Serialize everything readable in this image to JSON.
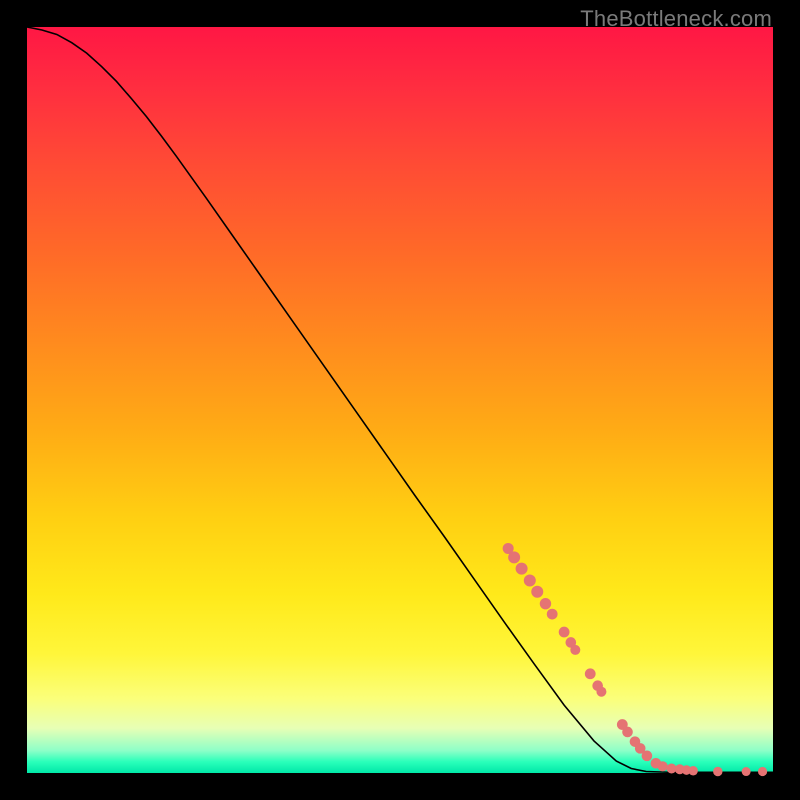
{
  "watermark": "TheBottleneck.com",
  "chart_data": {
    "type": "line",
    "title": "",
    "xlabel": "",
    "ylabel": "",
    "xlim": [
      0,
      100
    ],
    "ylim": [
      0,
      100
    ],
    "curve_points": [
      {
        "x": 0.0,
        "y": 100.0
      },
      {
        "x": 2.0,
        "y": 99.6
      },
      {
        "x": 4.0,
        "y": 99.0
      },
      {
        "x": 6.0,
        "y": 97.9
      },
      {
        "x": 8.0,
        "y": 96.5
      },
      {
        "x": 10.0,
        "y": 94.7
      },
      {
        "x": 12.0,
        "y": 92.7
      },
      {
        "x": 14.0,
        "y": 90.4
      },
      {
        "x": 16.0,
        "y": 88.0
      },
      {
        "x": 18.0,
        "y": 85.4
      },
      {
        "x": 20.0,
        "y": 82.7
      },
      {
        "x": 24.0,
        "y": 77.1
      },
      {
        "x": 28.0,
        "y": 71.4
      },
      {
        "x": 32.0,
        "y": 65.7
      },
      {
        "x": 36.0,
        "y": 60.0
      },
      {
        "x": 40.0,
        "y": 54.3
      },
      {
        "x": 44.0,
        "y": 48.6
      },
      {
        "x": 48.0,
        "y": 42.9
      },
      {
        "x": 52.0,
        "y": 37.2
      },
      {
        "x": 56.0,
        "y": 31.6
      },
      {
        "x": 60.0,
        "y": 25.9
      },
      {
        "x": 64.0,
        "y": 20.2
      },
      {
        "x": 68.0,
        "y": 14.6
      },
      {
        "x": 72.0,
        "y": 9.1
      },
      {
        "x": 76.0,
        "y": 4.3
      },
      {
        "x": 79.0,
        "y": 1.6
      },
      {
        "x": 81.0,
        "y": 0.6
      },
      {
        "x": 83.0,
        "y": 0.2
      },
      {
        "x": 86.0,
        "y": 0.1
      },
      {
        "x": 90.0,
        "y": 0.1
      },
      {
        "x": 95.0,
        "y": 0.1
      },
      {
        "x": 100.0,
        "y": 0.1
      }
    ],
    "markers": [
      {
        "x": 64.5,
        "y": 30.1,
        "r": 5.5
      },
      {
        "x": 65.3,
        "y": 28.9,
        "r": 6.0
      },
      {
        "x": 66.3,
        "y": 27.4,
        "r": 6.0
      },
      {
        "x": 67.4,
        "y": 25.8,
        "r": 6.0
      },
      {
        "x": 68.4,
        "y": 24.3,
        "r": 6.0
      },
      {
        "x": 69.5,
        "y": 22.7,
        "r": 5.7
      },
      {
        "x": 70.4,
        "y": 21.3,
        "r": 5.4
      },
      {
        "x": 72.0,
        "y": 18.9,
        "r": 5.4
      },
      {
        "x": 72.9,
        "y": 17.5,
        "r": 5.3
      },
      {
        "x": 73.5,
        "y": 16.5,
        "r": 5.0
      },
      {
        "x": 75.5,
        "y": 13.3,
        "r": 5.4
      },
      {
        "x": 76.5,
        "y": 11.7,
        "r": 5.3
      },
      {
        "x": 77.0,
        "y": 10.9,
        "r": 5.0
      },
      {
        "x": 79.8,
        "y": 6.5,
        "r": 5.4
      },
      {
        "x": 80.5,
        "y": 5.5,
        "r": 5.3
      },
      {
        "x": 81.5,
        "y": 4.2,
        "r": 5.3
      },
      {
        "x": 82.2,
        "y": 3.3,
        "r": 5.3
      },
      {
        "x": 83.1,
        "y": 2.3,
        "r": 5.3
      },
      {
        "x": 84.3,
        "y": 1.3,
        "r": 5.3
      },
      {
        "x": 85.2,
        "y": 0.9,
        "r": 5.1
      },
      {
        "x": 86.4,
        "y": 0.6,
        "r": 5.0
      },
      {
        "x": 87.5,
        "y": 0.5,
        "r": 5.0
      },
      {
        "x": 88.4,
        "y": 0.4,
        "r": 4.8
      },
      {
        "x": 89.3,
        "y": 0.3,
        "r": 4.7
      },
      {
        "x": 92.6,
        "y": 0.2,
        "r": 4.7
      },
      {
        "x": 96.4,
        "y": 0.2,
        "r": 4.5
      },
      {
        "x": 98.6,
        "y": 0.2,
        "r": 4.6
      }
    ]
  },
  "colors": {
    "background": "#000000",
    "marker": "#e57373",
    "curve": "#000000"
  }
}
